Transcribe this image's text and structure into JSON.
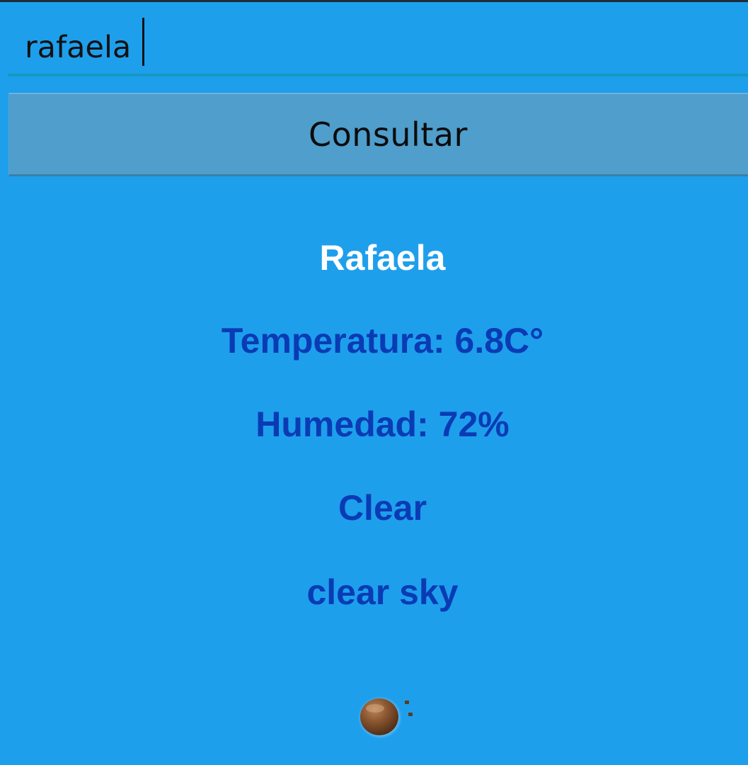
{
  "search": {
    "value": "rafaela"
  },
  "consult_button": {
    "label": "Consultar"
  },
  "weather": {
    "city": "Rafaela",
    "temperature": "Temperatura: 6.8C°",
    "humidity": "Humedad: 72%",
    "main": "Clear",
    "description": "clear sky",
    "icon": "clear-sky-icon"
  }
}
